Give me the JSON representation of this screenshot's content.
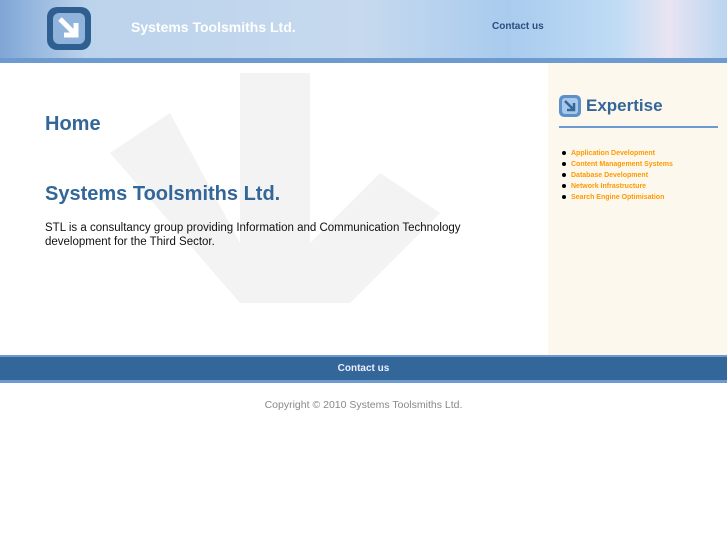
{
  "header": {
    "site_title": "Systems Toolsmiths Ltd.",
    "contact_link": "Contact us"
  },
  "main": {
    "heading": "Home",
    "subheading": "Systems Toolsmiths Ltd.",
    "intro": "STL is a consultancy group providing Information and Communication Technology development for the Third Sector."
  },
  "sidebar": {
    "title": "Expertise",
    "items": [
      "Application Development",
      "Content Management Systems",
      "Database Development",
      "Network Infrastructure",
      "Search Engine Optimisation"
    ]
  },
  "footer": {
    "contact_link": "Contact us",
    "copyright": "Copyright © 2010 Systems Toolsmiths Ltd."
  },
  "colors": {
    "brand": "#336699",
    "accent": "#ff9900",
    "sidebar_bg": "#fdf8ee"
  }
}
